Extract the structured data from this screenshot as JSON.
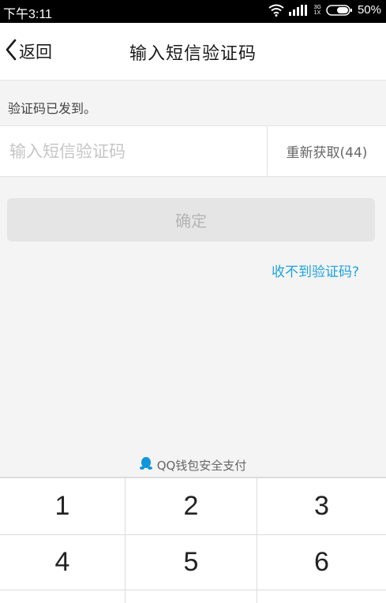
{
  "status_bar": {
    "time": "下午3:11",
    "network": "3G",
    "network_sub": "1X",
    "battery": "50%"
  },
  "nav": {
    "back_label": "返回",
    "title": "输入短信验证码"
  },
  "form": {
    "sent_hint": "验证码已发到。",
    "code_placeholder": "输入短信验证码",
    "code_value": "",
    "resend_label": "重新获取(44)",
    "confirm_label": "确定",
    "no_code_link": "收不到验证码?"
  },
  "keypad": {
    "brand_text": "QQ钱包安全支付",
    "keys": [
      "1",
      "2",
      "3",
      "4",
      "5",
      "6"
    ]
  },
  "colors": {
    "accent": "#1ea3e0",
    "qq_icon": "#1296db",
    "disabled_button": "#e5e5e5"
  }
}
